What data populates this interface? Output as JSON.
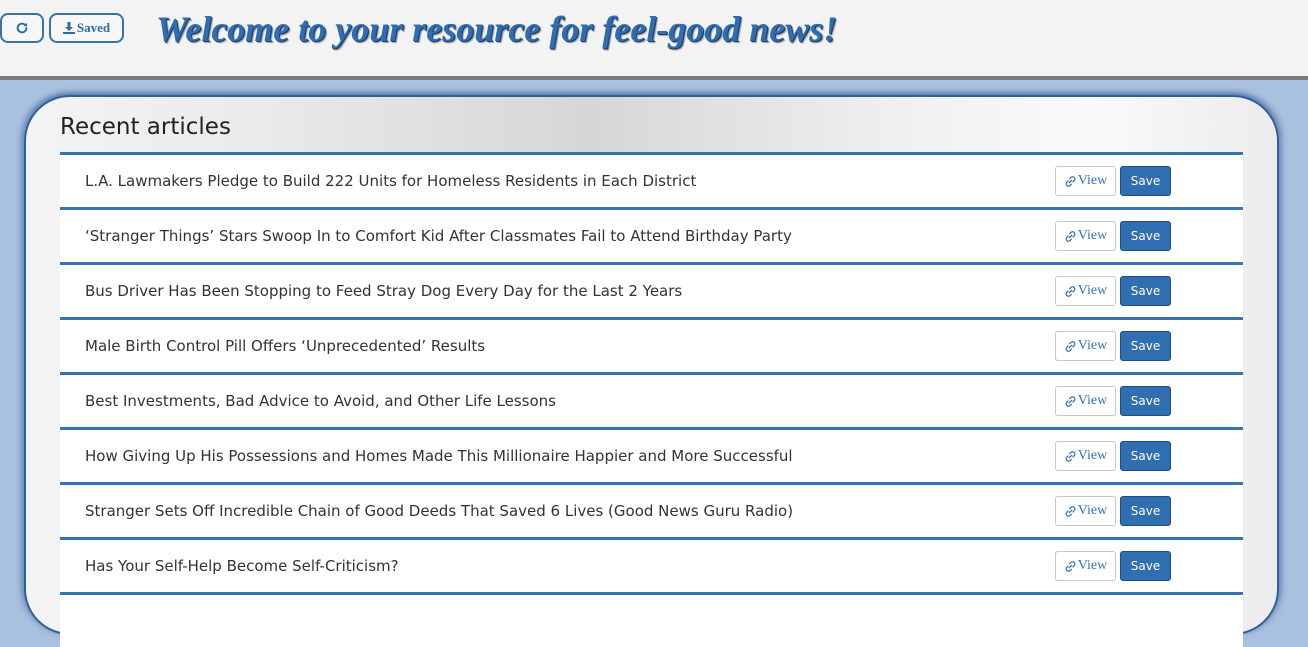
{
  "header": {
    "refresh_icon": "refresh-icon",
    "saved_label": "Saved",
    "saved_icon": "download-icon",
    "title": "Welcome to your resource for feel-good news!"
  },
  "main": {
    "heading": "Recent articles",
    "view_label": "View",
    "save_label": "Save",
    "articles": [
      {
        "title": "L.A. Lawmakers Pledge to Build 222 Units for Homeless Residents in Each District"
      },
      {
        "title": "‘Stranger Things’ Stars Swoop In to Comfort Kid After Classmates Fail to Attend Birthday Party"
      },
      {
        "title": "Bus Driver Has Been Stopping to Feed Stray Dog Every Day for the Last 2 Years"
      },
      {
        "title": "Male Birth Control Pill Offers ‘Unprecedented’ Results"
      },
      {
        "title": "Best Investments, Bad Advice to Avoid, and Other Life Lessons"
      },
      {
        "title": "How Giving Up His Possessions and Homes Made This Millionaire Happier and More Successful"
      },
      {
        "title": "Stranger Sets Off Incredible Chain of Good Deeds That Saved 6 Lives (Good News Guru Radio)"
      },
      {
        "title": "Has Your Self-Help Become Self-Criticism?"
      },
      {
        "title": ""
      }
    ]
  },
  "colors": {
    "accent": "#2f6eb0",
    "title": "#2f6cb0",
    "page_bg": "#a9c0df"
  }
}
